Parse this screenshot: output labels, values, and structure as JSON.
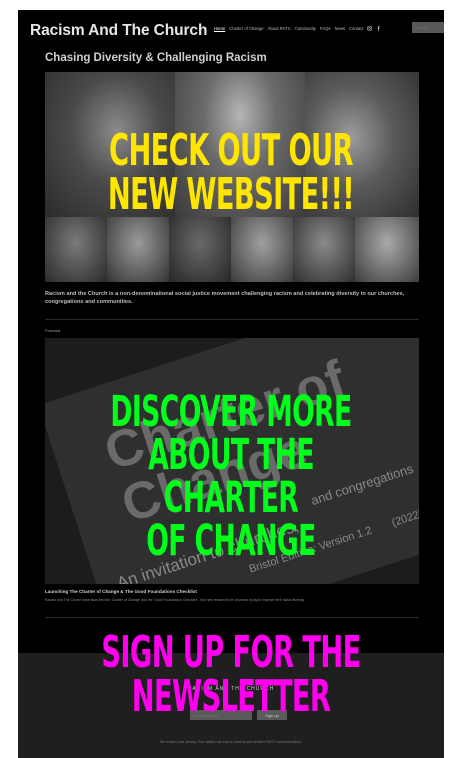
{
  "header": {
    "site_title": "Racism And The Church",
    "nav": [
      "Home",
      "Charter of Change",
      "About RATC",
      "Community",
      "FAQs",
      "News",
      "Contact"
    ],
    "search_placeholder": "Search"
  },
  "tagline": "Chasing Diversity & Challenging Racism",
  "overlays": {
    "website": [
      "CHECK OUT OUR",
      "NEW WEBSITE!!!"
    ],
    "charter": [
      "DISCOVER MORE",
      "ABOUT THE CHARTER",
      "OF CHANGE"
    ],
    "newsletter": [
      "SIGN UP FOR THE",
      "NEWSLETTER"
    ]
  },
  "intro": "Racism and the Church is a non-denominational social justice movement challenging racism and celebrating diversity in our churches, congregations and communities.",
  "featured": {
    "label": "Featured",
    "image_text": [
      "Charter of",
      "Change",
      "An invitation to churches,",
      "and congregations",
      "Bristol Edition: Version 1.2",
      "(2022)"
    ],
    "title": "Launching The Charter of Change & The Good Foundations Checklist",
    "excerpt": "Racism and The Church have launched the 'Charter of Change' and the 'Good Foundations Checklist' - two new resources for churches trying to improve their racial diversity."
  },
  "newsletter": {
    "heading": "RACISM AND THE CHURCH",
    "email_placeholder": "Email address",
    "button": "Sign up",
    "privacy": "We respect your privacy. Your details will only be used as part of direct RATC communications."
  },
  "colors": {
    "page_bg": "#000000",
    "promo_yellow": "#ffe600",
    "promo_green": "#00ff1a",
    "promo_magenta": "#ff00ee"
  }
}
